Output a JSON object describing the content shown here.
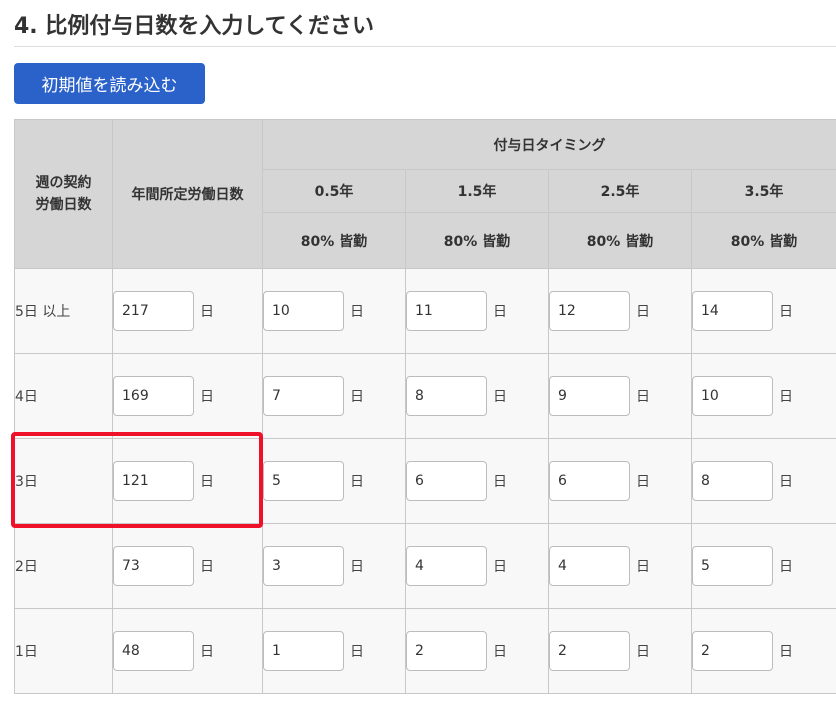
{
  "section": {
    "title": "4. 比例付与日数を入力してください",
    "load_button_label": "初期値を読み込む"
  },
  "table": {
    "header": {
      "week_line1": "週の契約",
      "week_line2": "労働日数",
      "annual": "年間所定労働日数",
      "timing": "付与日タイミング",
      "years": [
        "0.5年",
        "1.5年",
        "2.5年",
        "3.5年"
      ],
      "conditions": [
        "80% 皆勤",
        "80% 皆勤",
        "80% 皆勤",
        "80% 皆勤"
      ]
    },
    "unit": "日",
    "rows": [
      {
        "week": "5日 以上",
        "annual": "217",
        "grants": [
          "10",
          "11",
          "12",
          "14"
        ]
      },
      {
        "week": "4日",
        "annual": "169",
        "grants": [
          "7",
          "8",
          "9",
          "10"
        ]
      },
      {
        "week": "3日",
        "annual": "121",
        "grants": [
          "5",
          "6",
          "6",
          "8"
        ]
      },
      {
        "week": "2日",
        "annual": "73",
        "grants": [
          "3",
          "4",
          "4",
          "5"
        ]
      },
      {
        "week": "1日",
        "annual": "48",
        "grants": [
          "1",
          "2",
          "2",
          "2"
        ]
      }
    ]
  },
  "highlight_color": "#f0102a",
  "accent_color": "#2a62c9"
}
